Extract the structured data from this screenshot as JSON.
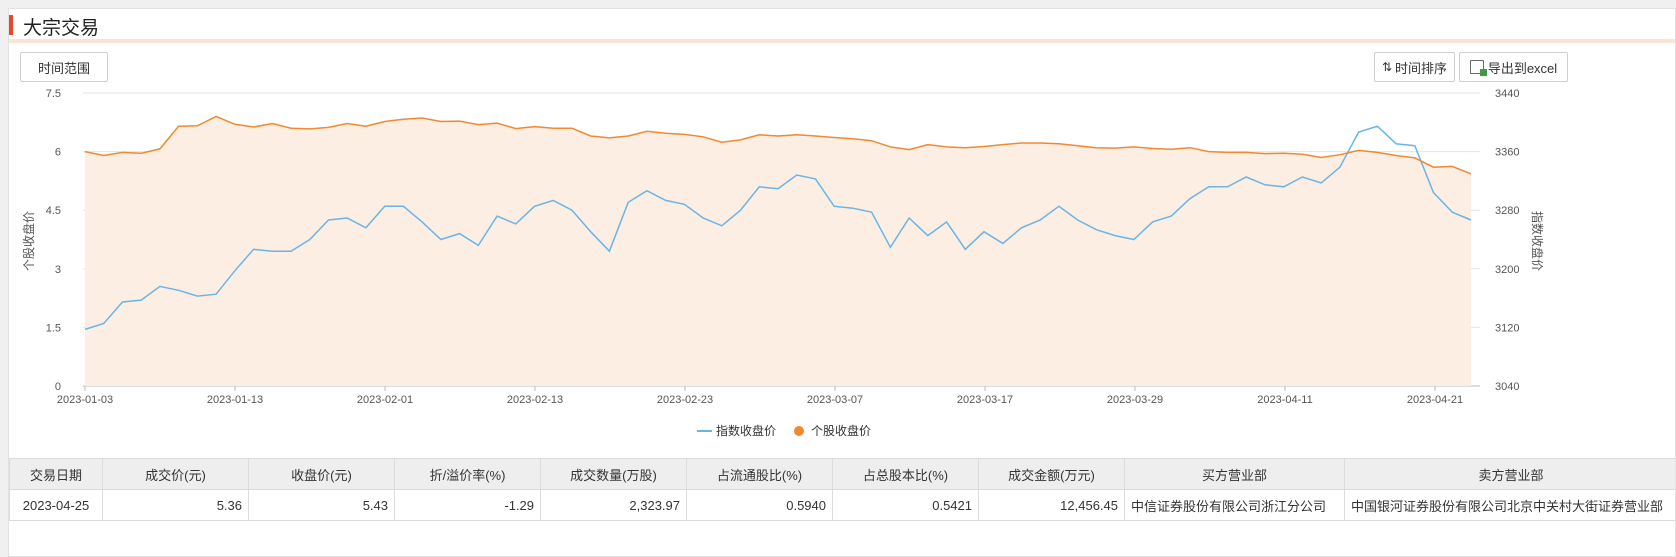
{
  "section": {
    "title": "大宗交易"
  },
  "toolbar": {
    "time_range_label": "时间范围",
    "sort_label": "时间排序",
    "export_label": "导出到excel"
  },
  "colors": {
    "index_line": "#6ab4e6",
    "stock_line": "#f08a30",
    "area_fill": "#fdeee3",
    "accent": "#e8472b"
  },
  "chart_data": {
    "type": "line",
    "x_ticks": [
      "2023-01-03",
      "2023-01-13",
      "2023-02-01",
      "2023-02-13",
      "2023-02-23",
      "2023-03-07",
      "2023-03-17",
      "2023-03-29",
      "2023-04-11",
      "2023-04-21"
    ],
    "y_left": {
      "label": "个股收盘价",
      "min": 0,
      "max": 7.5,
      "ticks": [
        "0",
        "1.5",
        "3",
        "4.5",
        "6",
        "7.5"
      ]
    },
    "y_right": {
      "label": "指数收盘价",
      "min": 3040,
      "max": 3440,
      "ticks": [
        "3040",
        "3120",
        "3200",
        "3280",
        "3360",
        "3440"
      ]
    },
    "legend": [
      "指数收盘价",
      "个股收盘价"
    ],
    "legend_position": "bottom-center",
    "grid": true,
    "series": [
      {
        "name": "指数收盘价",
        "axis": "left",
        "values": [
          1.45,
          1.6,
          2.15,
          2.2,
          2.55,
          2.45,
          2.3,
          2.35,
          2.95,
          3.5,
          3.45,
          3.45,
          3.75,
          4.25,
          4.3,
          4.05,
          4.6,
          4.6,
          4.2,
          3.75,
          3.9,
          3.6,
          4.35,
          4.15,
          4.6,
          4.75,
          4.5,
          3.95,
          3.45,
          4.7,
          5.0,
          4.75,
          4.65,
          4.3,
          4.1,
          4.5,
          5.1,
          5.05,
          5.4,
          5.3,
          4.6,
          4.55,
          4.45,
          3.55,
          4.3,
          3.85,
          4.2,
          3.5,
          3.95,
          3.65,
          4.05,
          4.25,
          4.6,
          4.25,
          4.0,
          3.85,
          3.75,
          4.2,
          4.35,
          4.8,
          5.1,
          5.1,
          5.35,
          5.15,
          5.1,
          5.35,
          5.2,
          5.6,
          6.5,
          6.65,
          6.2,
          6.15,
          4.95,
          4.45,
          4.25
        ]
      },
      {
        "name": "个股收盘价",
        "axis": "left",
        "values": [
          6.0,
          5.9,
          5.98,
          5.96,
          6.07,
          6.65,
          6.66,
          6.9,
          6.7,
          6.63,
          6.72,
          6.6,
          6.58,
          6.62,
          6.72,
          6.65,
          6.77,
          6.83,
          6.86,
          6.77,
          6.78,
          6.69,
          6.73,
          6.59,
          6.64,
          6.6,
          6.6,
          6.4,
          6.35,
          6.4,
          6.52,
          6.47,
          6.44,
          6.38,
          6.24,
          6.3,
          6.43,
          6.4,
          6.43,
          6.4,
          6.36,
          6.33,
          6.28,
          6.12,
          6.05,
          6.18,
          6.12,
          6.1,
          6.13,
          6.18,
          6.22,
          6.22,
          6.2,
          6.15,
          6.1,
          6.09,
          6.12,
          6.08,
          6.06,
          6.1,
          6.0,
          5.98,
          5.98,
          5.95,
          5.96,
          5.93,
          5.85,
          5.92,
          6.03,
          5.98,
          5.9,
          5.84,
          5.6,
          5.62,
          5.43
        ]
      }
    ]
  },
  "table": {
    "headers": [
      "交易日期",
      "成交价(元)",
      "收盘价(元)",
      "折/溢价率(%)",
      "成交数量(万股)",
      "占流通股比(%)",
      "占总股本比(%)",
      "成交金额(万元)",
      "买方营业部",
      "卖方营业部"
    ],
    "rows": [
      [
        "2023-04-25",
        "5.36",
        "5.43",
        "-1.29",
        "2,323.97",
        "0.5940",
        "0.5421",
        "12,456.45",
        "中信证券股份有限公司浙江分公司",
        "中国银河证券股份有限公司北京中关村大街证券营业部"
      ]
    ]
  }
}
